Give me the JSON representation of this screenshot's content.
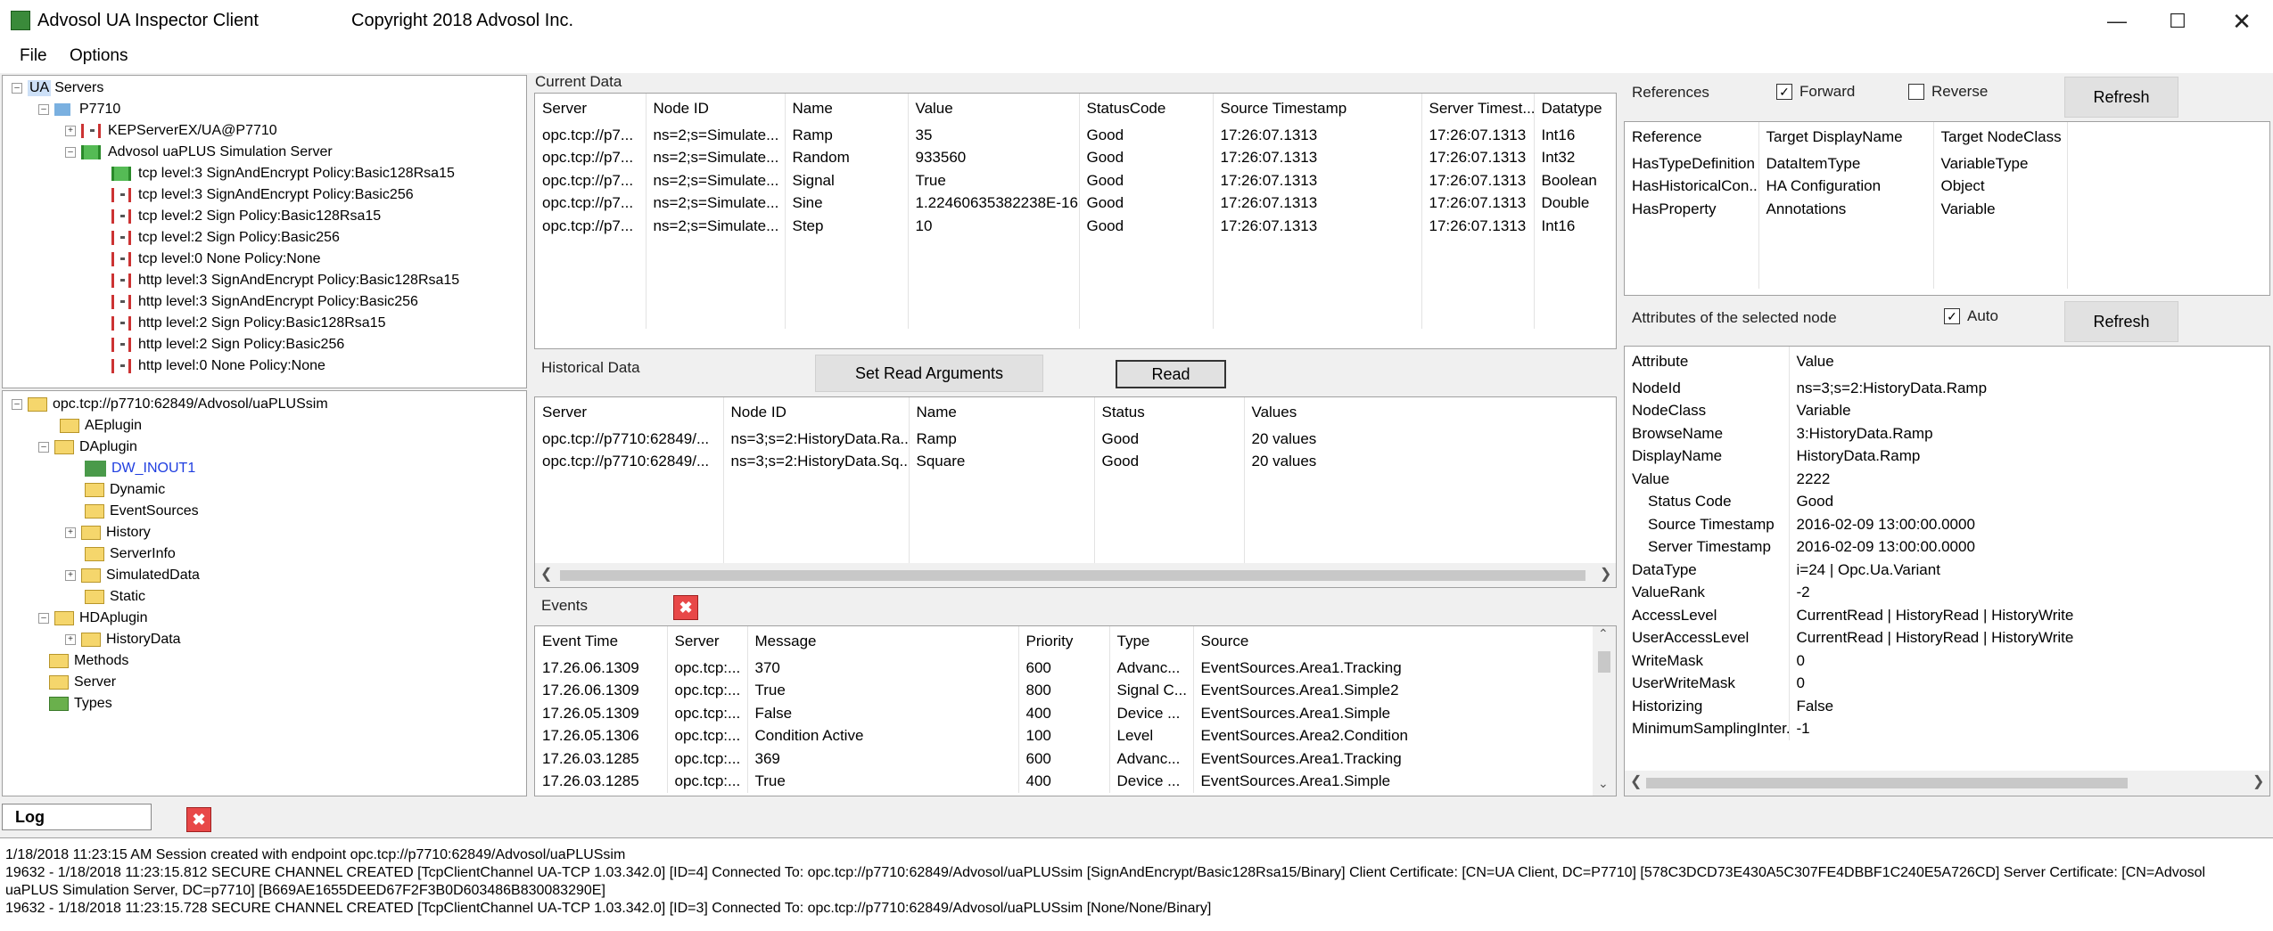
{
  "window": {
    "title": "Advosol UA Inspector Client",
    "copyright": "Copyright 2018  Advosol Inc.",
    "min_icon": "minimize-icon",
    "max_icon": "maximize-icon",
    "close_icon": "close-icon"
  },
  "menu": {
    "file": "File",
    "options": "Options"
  },
  "server_tree": {
    "root": "Servers",
    "root_prefix": "UA",
    "host": "P7710",
    "items": [
      "KEPServerEX/UA@P7710",
      "Advosol uaPLUS Simulation Server",
      "tcp level:3 SignAndEncrypt Policy:Basic128Rsa15",
      "tcp level:3 SignAndEncrypt Policy:Basic256",
      "tcp level:2 Sign Policy:Basic128Rsa15",
      "tcp level:2 Sign Policy:Basic256",
      "tcp level:0 None Policy:None",
      "http level:3 SignAndEncrypt Policy:Basic128Rsa15",
      "http level:3 SignAndEncrypt Policy:Basic256",
      "http level:2 Sign Policy:Basic128Rsa15",
      "http level:2 Sign Policy:Basic256",
      "http level:0 None Policy:None"
    ]
  },
  "address_tree": {
    "root": "opc.tcp://p7710:62849/Advosol/uaPLUSsim",
    "items": [
      "AEplugin",
      "DAplugin",
      "DW_INOUT1",
      "Dynamic",
      "EventSources",
      "History",
      "ServerInfo",
      "SimulatedData",
      "Static",
      "HDAplugin",
      "HistoryData",
      "Methods",
      "Server",
      "Types"
    ]
  },
  "current_data": {
    "label": "Current Data",
    "columns": [
      "Server",
      "Node ID",
      "Name",
      "Value",
      "StatusCode",
      "Source Timestamp",
      "Server Timest...",
      "Datatype"
    ],
    "rows": [
      [
        "opc.tcp://p7...",
        "ns=2;s=Simulate...",
        "Ramp",
        "35",
        "Good",
        "17:26:07.1313",
        "17:26:07.1313",
        "Int16"
      ],
      [
        "opc.tcp://p7...",
        "ns=2;s=Simulate...",
        "Random",
        "933560",
        "Good",
        "17:26:07.1313",
        "17:26:07.1313",
        "Int32"
      ],
      [
        "opc.tcp://p7...",
        "ns=2;s=Simulate...",
        "Signal",
        "True",
        "Good",
        "17:26:07.1313",
        "17:26:07.1313",
        "Boolean"
      ],
      [
        "opc.tcp://p7...",
        "ns=2;s=Simulate...",
        "Sine",
        "1.22460635382238E-16",
        "Good",
        "17:26:07.1313",
        "17:26:07.1313",
        "Double"
      ],
      [
        "opc.tcp://p7...",
        "ns=2;s=Simulate...",
        "Step",
        "10",
        "Good",
        "17:26:07.1313",
        "17:26:07.1313",
        "Int16"
      ]
    ]
  },
  "historical_data": {
    "label": "Historical Data",
    "set_args": "Set Read Arguments",
    "read": "Read",
    "columns": [
      "Server",
      "Node ID",
      "Name",
      "Status",
      "Values"
    ],
    "rows": [
      [
        "opc.tcp://p7710:62849/...",
        "ns=3;s=2:HistoryData.Ra...",
        "Ramp",
        "Good",
        "20 values"
      ],
      [
        "opc.tcp://p7710:62849/...",
        "ns=3;s=2:HistoryData.Sq...",
        "Square",
        "Good",
        "20 values"
      ]
    ]
  },
  "events": {
    "label": "Events",
    "columns": [
      "Event Time",
      "Server",
      "Message",
      "Priority",
      "Type",
      "Source"
    ],
    "rows": [
      [
        "17.26.06.1309",
        "opc.tcp:...",
        "370",
        "600",
        "Advanc...",
        "EventSources.Area1.Tracking"
      ],
      [
        "17.26.06.1309",
        "opc.tcp:...",
        "True",
        "800",
        "Signal C...",
        "EventSources.Area1.Simple2"
      ],
      [
        "17.26.05.1309",
        "opc.tcp:...",
        "False",
        "400",
        "Device ...",
        "EventSources.Area1.Simple"
      ],
      [
        "17.26.05.1306",
        "opc.tcp:...",
        "Condition Active",
        "100",
        "Level",
        "EventSources.Area2.Condition"
      ],
      [
        "17.26.03.1285",
        "opc.tcp:...",
        "369",
        "600",
        "Advanc...",
        "EventSources.Area1.Tracking"
      ],
      [
        "17.26.03.1285",
        "opc.tcp:...",
        "True",
        "400",
        "Device ...",
        "EventSources.Area1.Simple"
      ]
    ]
  },
  "references": {
    "label": "References",
    "forward": "Forward",
    "reverse": "Reverse",
    "refresh": "Refresh",
    "columns": [
      "Reference",
      "Target DisplayName",
      "Target NodeClass"
    ],
    "rows": [
      [
        "HasTypeDefinition",
        "DataItemType",
        "VariableType"
      ],
      [
        "HasHistoricalCon...",
        "HA Configuration",
        "Object"
      ],
      [
        "HasProperty",
        "Annotations",
        "Variable"
      ]
    ]
  },
  "attributes": {
    "label": "Attributes of the selected node",
    "auto": "Auto",
    "refresh": "Refresh",
    "columns": [
      "Attribute",
      "Value"
    ],
    "rows": [
      [
        "NodeId",
        "ns=3;s=2:HistoryData.Ramp"
      ],
      [
        "NodeClass",
        "Variable"
      ],
      [
        "BrowseName",
        "3:HistoryData.Ramp"
      ],
      [
        "DisplayName",
        "HistoryData.Ramp"
      ],
      [
        "Value",
        "2222"
      ],
      [
        "Status Code",
        "Good"
      ],
      [
        "Source Timestamp",
        "2016-02-09 13:00:00.0000"
      ],
      [
        "Server Timestamp",
        "2016-02-09 13:00:00.0000"
      ],
      [
        "DataType",
        "i=24 | Opc.Ua.Variant"
      ],
      [
        "ValueRank",
        "-2"
      ],
      [
        "AccessLevel",
        "CurrentRead | HistoryRead | HistoryWrite"
      ],
      [
        "UserAccessLevel",
        "CurrentRead | HistoryRead | HistoryWrite"
      ],
      [
        "WriteMask",
        "0"
      ],
      [
        "UserWriteMask",
        "0"
      ],
      [
        "Historizing",
        "False"
      ],
      [
        "MinimumSamplingInter...",
        "-1"
      ]
    ]
  },
  "log": {
    "label": "Log",
    "lines": [
      "1/18/2018 11:23:15 AM Session created with endpoint opc.tcp://p7710:62849/Advosol/uaPLUSsim",
      "19632 - 1/18/2018 11:23:15.812 SECURE CHANNEL CREATED [TcpClientChannel UA-TCP 1.03.342.0] [ID=4] Connected To: opc.tcp://p7710:62849/Advosol/uaPLUSsim [SignAndEncrypt/Basic128Rsa15/Binary] Client Certificate: [CN=UA Client, DC=P7710] [578C3DCD73E430A5C307FE4DBBF1C240E5A726CD] Server Certificate: [CN=Advosol",
      "uaPLUS Simulation Server, DC=p7710] [B669AE1655DEED67F2F3B0D603486B830083290E]",
      "19632 - 1/18/2018 11:23:15.728 SECURE CHANNEL CREATED [TcpClientChannel UA-TCP 1.03.342.0] [ID=3] Connected To: opc.tcp://p7710:62849/Advosol/uaPLUSsim [None/None/Binary]"
    ]
  }
}
